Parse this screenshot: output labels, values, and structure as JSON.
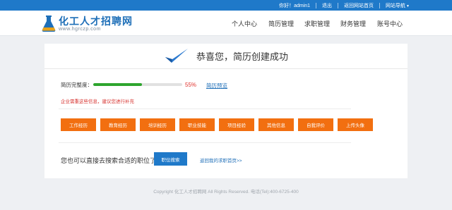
{
  "topbar": {
    "greeting": "你好！admin1",
    "logout": "退出",
    "home": "返回网站首页",
    "site_nav": "网站导航",
    "site_nav_caret": "▼"
  },
  "logo": {
    "title": "化工人才招聘网",
    "url": "www.hgrczp.com"
  },
  "nav": [
    "个人中心",
    "简历管理",
    "求职管理",
    "财务管理",
    "账号中心"
  ],
  "success": {
    "title": "恭喜您，简历创建成功"
  },
  "resume": {
    "completeness_label": "简历完整度：",
    "percent_text": "55%",
    "percent": 0.55,
    "preview_link": "简历预览",
    "tip": "企业需重这些信息，建议您进行补充"
  },
  "buttons": [
    "工作经历",
    "教育经历",
    "培训经历",
    "职业技能",
    "项目经验",
    "其他信息",
    "自我评价",
    "上传头像"
  ],
  "search": {
    "text": "您也可以直接去搜索合适的职位了",
    "button": "职位搜索",
    "back_link": "返回我的求职首页>>"
  },
  "footer": {
    "text": "Copyright 化工人才招聘网 All Rights Reserved. 电话(Tel):400-6725-400"
  },
  "colors": {
    "topbar": "#1f79c9",
    "accent_orange": "#f26f10",
    "progress_green": "#2ea52e",
    "alert_red": "#d7332f",
    "link_blue": "#1f6fb8"
  }
}
